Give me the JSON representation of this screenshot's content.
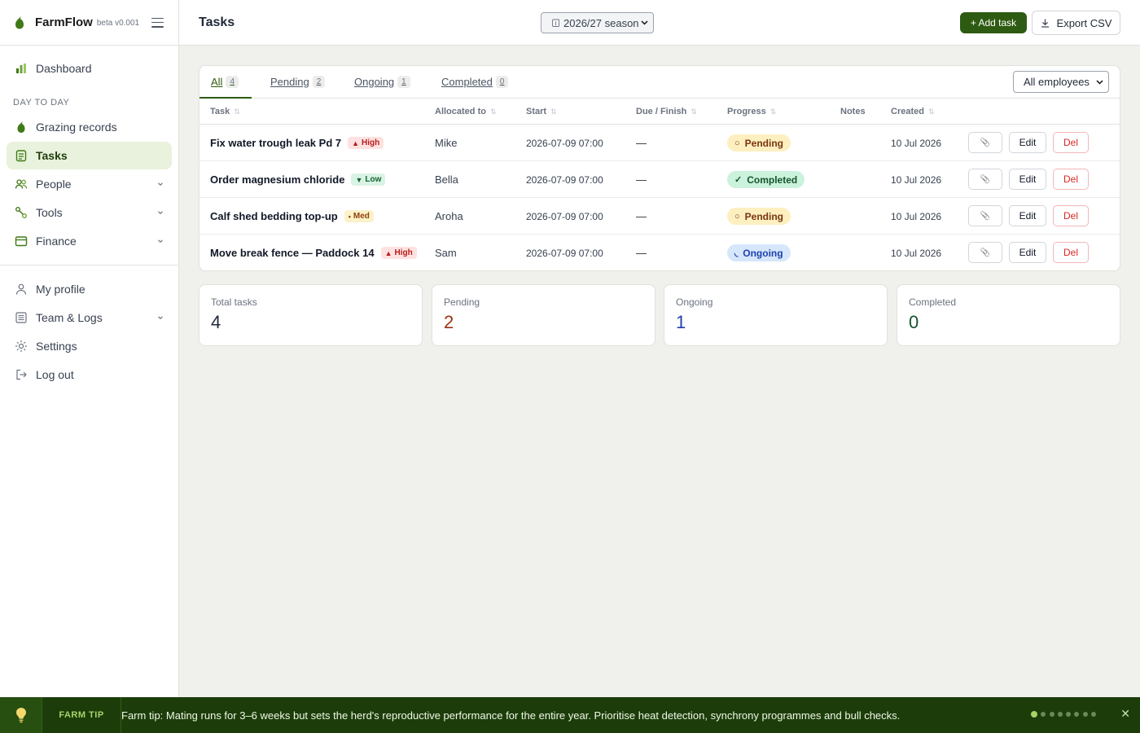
{
  "brand": {
    "name": "FarmFlow",
    "beta": "beta v0.001"
  },
  "nav": {
    "dashboard": "Dashboard",
    "section_day": "DAY TO DAY",
    "grazing": "Grazing records",
    "tasks": "Tasks",
    "people": "People",
    "tools": "Tools",
    "finance": "Finance",
    "profile": "My profile",
    "team_logs": "Team & Logs",
    "settings": "Settings",
    "logout": "Log out"
  },
  "header": {
    "title": "Tasks",
    "season": "2026/27 season",
    "add_task": "+ Add task",
    "export_csv": "Export CSV"
  },
  "tabs": [
    {
      "label": "All",
      "count": "4"
    },
    {
      "label": "Pending",
      "count": "2"
    },
    {
      "label": "Ongoing",
      "count": "1"
    },
    {
      "label": "Completed",
      "count": "0"
    }
  ],
  "employee_filter": "All employees",
  "columns": {
    "task": "Task",
    "allocated": "Allocated to",
    "start": "Start",
    "due": "Due / Finish",
    "progress": "Progress",
    "notes": "Notes",
    "created": "Created",
    "sort_glyph": "⇅"
  },
  "rows": [
    {
      "title": "Fix water trough leak Pd 7",
      "priority": "High",
      "priority_glyph": "▲",
      "allocated": "Mike",
      "start": "2026-07-09 07:00",
      "due": "—",
      "status": "Pending",
      "status_glyph": "○",
      "created": "10 Jul 2026"
    },
    {
      "title": "Order magnesium chloride",
      "priority": "Low",
      "priority_glyph": "▼",
      "allocated": "Bella",
      "start": "2026-07-09 07:00",
      "due": "—",
      "status": "Completed",
      "status_glyph": "✓",
      "created": "10 Jul 2026"
    },
    {
      "title": "Calf shed bedding top-up",
      "priority": "Med",
      "priority_glyph": "•",
      "allocated": "Aroha",
      "start": "2026-07-09 07:00",
      "due": "—",
      "status": "Pending",
      "status_glyph": "○",
      "created": "10 Jul 2026"
    },
    {
      "title": "Move break fence — Paddock 14",
      "priority": "High",
      "priority_glyph": "▲",
      "allocated": "Sam",
      "start": "2026-07-09 07:00",
      "due": "—",
      "status": "Ongoing",
      "status_glyph": "◟",
      "created": "10 Jul 2026"
    }
  ],
  "actions": {
    "attach": "📎",
    "edit": "Edit",
    "del": "Del"
  },
  "stats": [
    {
      "label": "Total tasks",
      "value": "4",
      "color": "#1f2937"
    },
    {
      "label": "Pending",
      "value": "2",
      "color": "#9a3412"
    },
    {
      "label": "Ongoing",
      "value": "1",
      "color": "#1e40af"
    },
    {
      "label": "Completed",
      "value": "0",
      "color": "#14532d"
    }
  ],
  "tip": {
    "label": "FARM TIP",
    "text": "Farm tip: Mating runs for 3–6 weeks but sets the herd's reproductive performance for the entire year. Prioritise heat detection, synchrony programmes and bull checks.",
    "close": "✕"
  },
  "colors": {
    "accent": "#2e5b12",
    "active_nav_bg": "#e9f2dc",
    "tipbar_bg": "#1c3d0a"
  }
}
